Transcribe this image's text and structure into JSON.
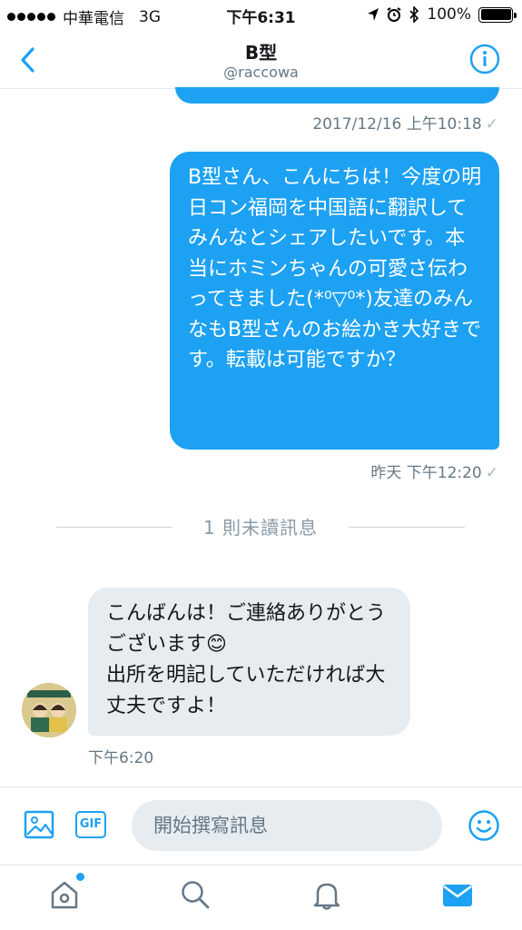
{
  "status_bar": {
    "carrier": "中華電信",
    "network": "3G",
    "time": "下午6:31",
    "battery": "100%"
  },
  "nav": {
    "title": "B型",
    "subtitle": "@raccowa"
  },
  "messages": {
    "timestamp_1": "2017/12/16 上午10:18",
    "outgoing_text": "B型さん、こんにちは！今度の明日コン福岡を中国語に翻訳してみんなとシェアしたいです。本当にホミンちゃんの可愛さ伝わってきました(*⁰▽⁰*)友達のみんなもB型さんのお絵かき大好きです。転載は可能ですか？",
    "timestamp_2": "昨天 下午12:20",
    "unread_divider": "1 則未讀訊息",
    "incoming_text": "こんばんは！ご連絡ありがとうございます😊\n出所を明記していただければ大丈夫ですよ！",
    "timestamp_3": "下午6:20",
    "check_mark": "✓"
  },
  "compose": {
    "gif_label": "GIF",
    "placeholder": "開始撰寫訊息"
  },
  "colors": {
    "accent": "#1da1f2",
    "incoming_bubble": "#e6ecf0",
    "muted_text": "#657786"
  },
  "icons": {
    "back": "chevron-left-icon",
    "info": "info-icon",
    "image": "image-icon",
    "emoji": "smiley-icon",
    "home": "home-icon",
    "search": "search-icon",
    "notifications": "bell-icon",
    "messages": "mail-icon"
  }
}
